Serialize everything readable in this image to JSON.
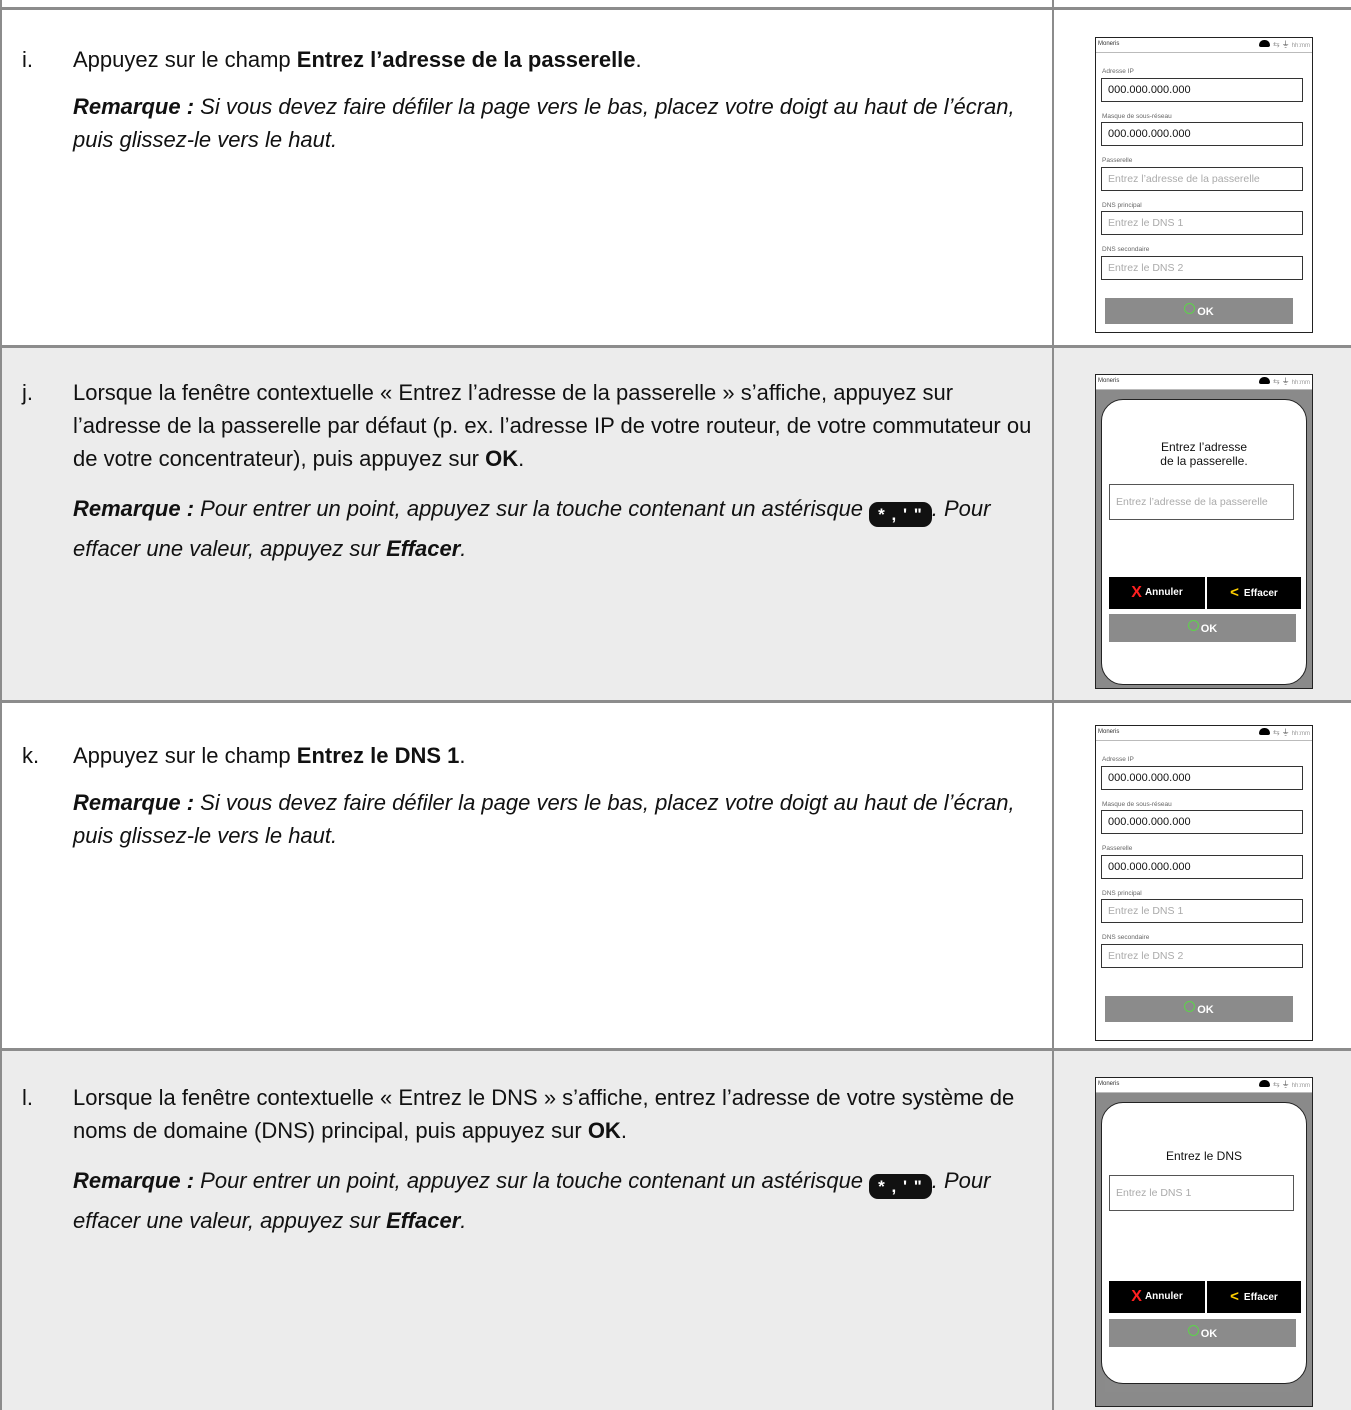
{
  "rows": [
    {
      "marker": "i.",
      "instruction_prefix": "Appuyez sur le champ ",
      "instruction_bold": "Entrez l’adresse de la passerelle",
      "instruction_suffix": ".",
      "note_label": "Remarque :",
      "note_text": " Si vous devez faire défiler la page vers le bas, placez votre doigt au haut de l’écran, puis glissez-le vers le haut."
    },
    {
      "marker": "j.",
      "instruction_prefix": "Lorsque la fenêtre contextuelle « Entrez l’adresse de la passerelle » s’affiche, appuyez sur l’adresse de la passerelle par défaut (p. ex. l’adresse IP de votre routeur, de votre commutateur ou de votre concentrateur), puis appuyez sur ",
      "instruction_bold": "OK",
      "instruction_suffix": ".",
      "note_label": "Remarque :",
      "note_text_1": " Pour entrer un point, appuyez sur la touche contenant un astérisque ",
      "note_text_2": ". Pour effacer une valeur, appuyez sur ",
      "note_bold": "Effacer",
      "note_end": "."
    },
    {
      "marker": "k.",
      "instruction_prefix": "Appuyez sur le champ ",
      "instruction_bold": "Entrez le DNS 1",
      "instruction_suffix": ".",
      "note_label": "Remarque :",
      "note_text": " Si vous devez faire défiler la page vers le bas, placez votre doigt au haut de l’écran, puis glissez-le vers le haut."
    },
    {
      "marker": "l.",
      "instruction_prefix": "Lorsque la fenêtre contextuelle « Entrez le DNS » s’affiche, entrez l’adresse de votre système de noms de domaine (DNS) principal, puis appuyez sur ",
      "instruction_bold": "OK",
      "instruction_suffix": ".",
      "note_label": "Remarque :",
      "note_text_1": " Pour entrer un point, appuyez sur la touche contenant un astérisque ",
      "note_text_2": ". Pour effacer une valeur, appuyez sur ",
      "note_bold": "Effacer",
      "note_end": "."
    }
  ],
  "keycap_label": "* , ' \"",
  "device": {
    "brand": "Moneris",
    "time": "hh:mm",
    "labels": {
      "ip": "Adresse IP",
      "mask": "Masque de sous-réseau",
      "gateway": "Passerelle",
      "dns1": "DNS principal",
      "dns2": "DNS secondaire"
    },
    "values": {
      "ip": "000.000.000.000",
      "mask": "000.000.000.000",
      "gateway_filled": "000.000.000.000"
    },
    "placeholders": {
      "gateway": "Entrez l’adresse de la passerelle",
      "dns1": "Entrez le DNS 1",
      "dns2": "Entrez le DNS 2"
    },
    "ok": "OK",
    "popup_gateway_title_1": "Entrez l’adresse",
    "popup_gateway_title_2": "de la passerelle.",
    "popup_dns_title": "Entrez le DNS",
    "cancel": "Annuler",
    "clear": "Effacer"
  }
}
